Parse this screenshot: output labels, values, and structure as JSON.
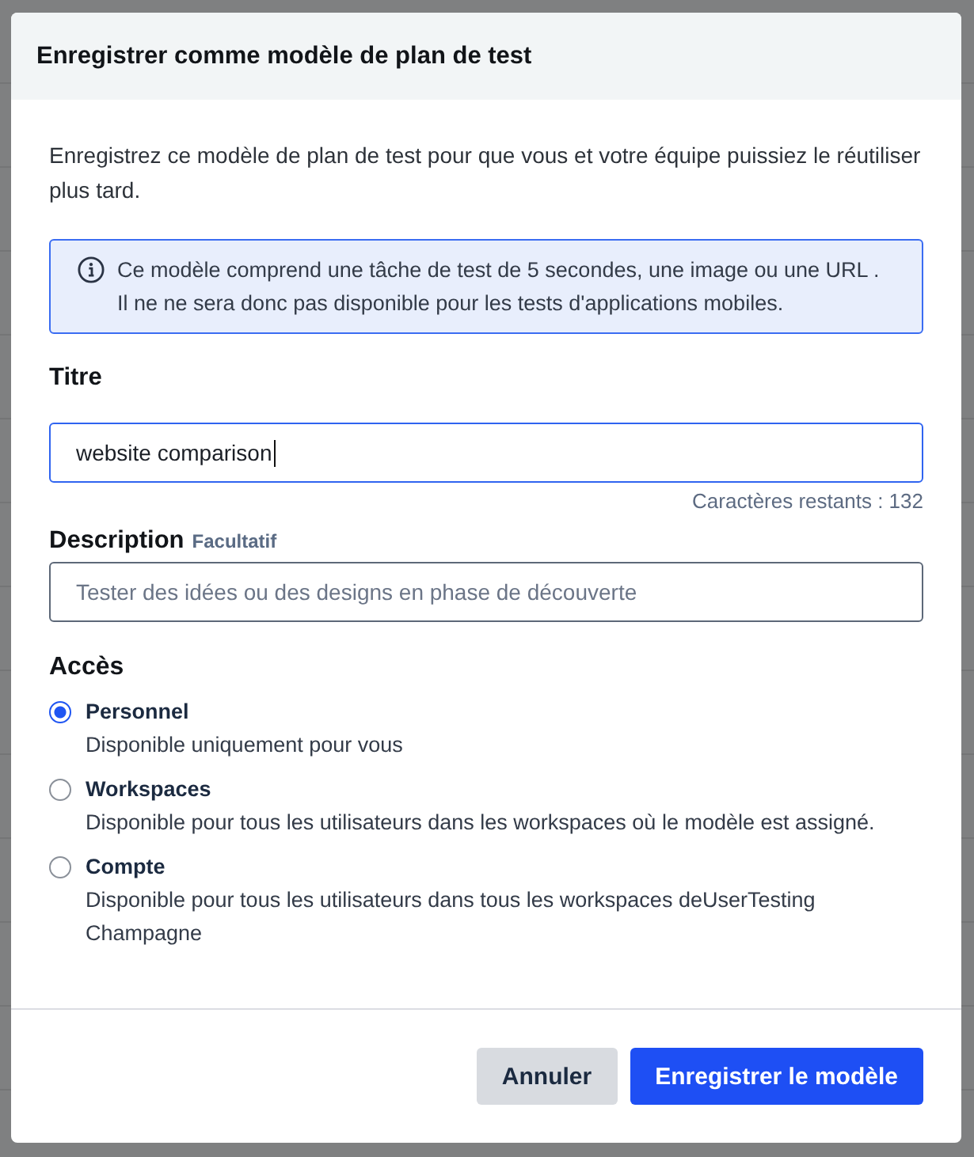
{
  "dialog": {
    "title": "Enregistrer comme modèle de plan de test",
    "intro": "Enregistrez ce modèle de plan de test pour que vous et votre équipe puissiez le réutiliser plus tard.",
    "notice": "Ce modèle comprend une tâche de test de 5 secondes, une image ou une URL . Il ne ne sera donc pas disponible pour les tests d'applications mobiles.",
    "fields": [
      {
        "label": "Titre",
        "value": "website comparison",
        "focused": true,
        "counter": "Caractères restants : 132"
      },
      {
        "label": "Description",
        "optional_tag": "Facultatif",
        "placeholder": "Tester des idées ou des designs en phase de découverte",
        "focused": false
      }
    ],
    "access": {
      "label": "Accès",
      "options": [
        {
          "label": "Personnel",
          "description": "Disponible uniquement pour vous",
          "selected": true
        },
        {
          "label": "Workspaces",
          "description": "Disponible pour tous les utilisateurs dans les workspaces où le modèle est assigné.",
          "selected": false
        },
        {
          "label": "Compte",
          "description": "Disponible pour tous les utilisateurs dans tous les workspaces deUserTesting Champagne",
          "selected": false
        }
      ]
    },
    "buttons": [
      {
        "label": "Annuler",
        "kind": "secondary"
      },
      {
        "label": "Enregistrer le modèle",
        "kind": "primary"
      }
    ]
  }
}
